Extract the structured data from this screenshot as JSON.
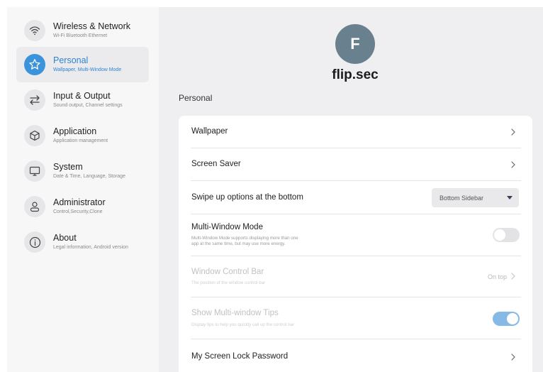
{
  "sidebar": {
    "items": [
      {
        "title": "Wireless & Network",
        "subtitle": "Wi-Fi Bluetooth Ethernet",
        "icon": "wifi-icon",
        "active": false
      },
      {
        "title": "Personal",
        "subtitle": "Wallpaper, Multi-Window Mode",
        "icon": "star-icon",
        "active": true
      },
      {
        "title": "Input & Output",
        "subtitle": "Sound output, Channel settings",
        "icon": "swap-arrows-icon",
        "active": false
      },
      {
        "title": "Application",
        "subtitle": "Application management",
        "icon": "cube-icon",
        "active": false
      },
      {
        "title": "System",
        "subtitle": "Date & Time, Language, Storage",
        "icon": "monitor-icon",
        "active": false
      },
      {
        "title": "Administrator",
        "subtitle": "Control,Security,Clone",
        "icon": "person-icon",
        "active": false
      },
      {
        "title": "About",
        "subtitle": "Legal information, Android version",
        "icon": "info-icon",
        "active": false
      }
    ]
  },
  "header": {
    "avatar_letter": "F",
    "device_name": "flip.sec"
  },
  "section": {
    "title": "Personal"
  },
  "settings": {
    "wallpaper": {
      "title": "Wallpaper"
    },
    "screen_saver": {
      "title": "Screen Saver"
    },
    "swipe_up": {
      "title": "Swipe up options at the bottom",
      "selected_option": "Bottom Sidebar"
    },
    "multi_window": {
      "title": "Multi-Window Mode",
      "subtitle_line1": "Multi-Window Mode supports displaying more than one",
      "subtitle_line2": "app at the same time, but may use more energy.",
      "enabled": false
    },
    "window_control_bar": {
      "title": "Window Control Bar",
      "subtitle": "The position of the window control bar",
      "value": "On top",
      "disabled": true
    },
    "multi_window_tips": {
      "title": "Show Multi-window Tips",
      "subtitle": "Display tips to help you quickly call up the control bar",
      "enabled": true,
      "disabled": true
    },
    "screen_lock": {
      "title": "My Screen Lock Password"
    }
  },
  "colors": {
    "accent": "#3a93db",
    "sidebar_bg": "#f7f7f8",
    "main_bg": "#efeff1",
    "avatar_bg": "#69818e",
    "toggle_on": "#85b9e6"
  }
}
